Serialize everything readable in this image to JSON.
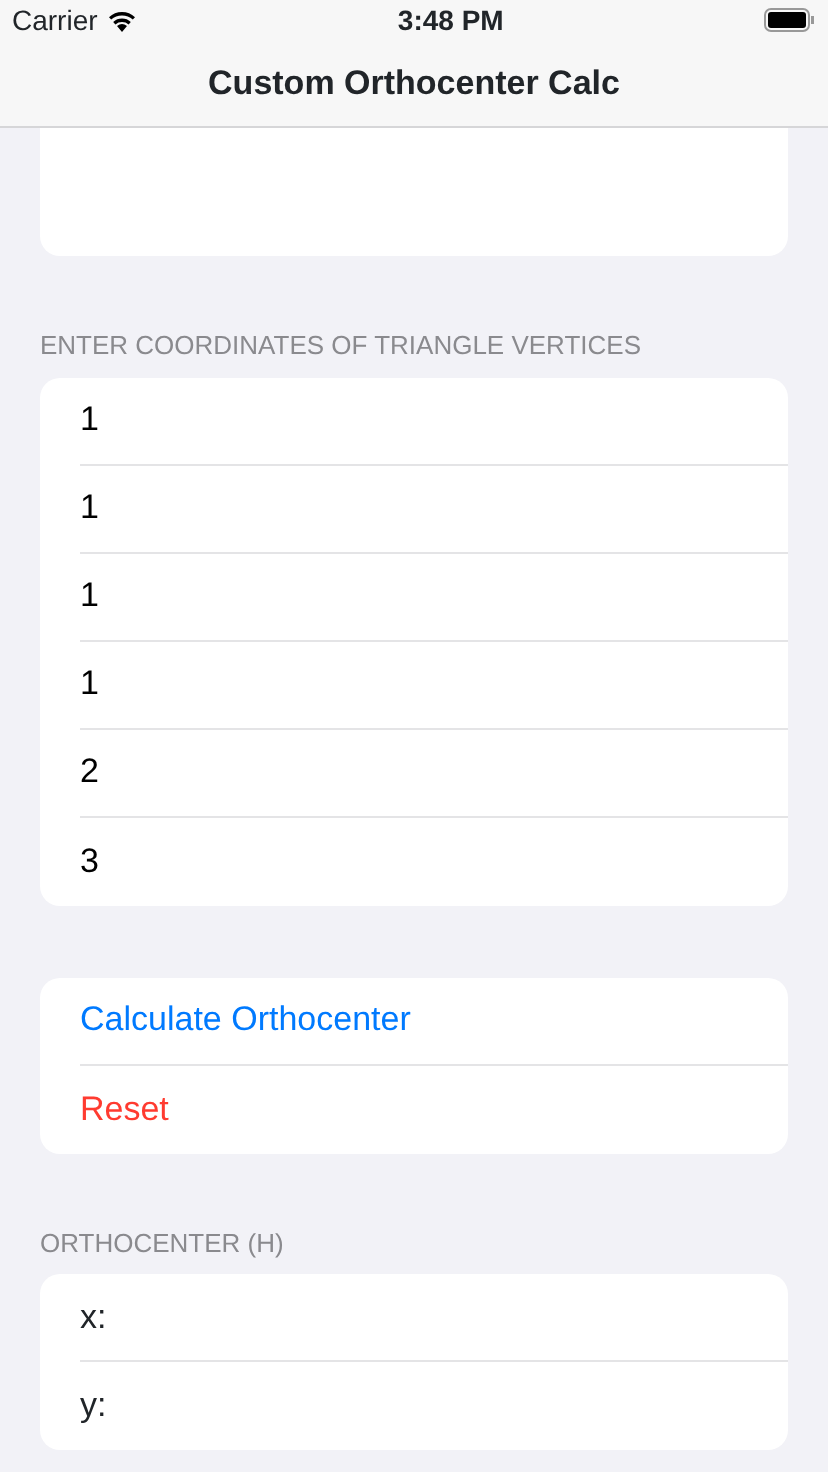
{
  "status_bar": {
    "carrier": "Carrier",
    "time": "3:48 PM"
  },
  "nav_bar": {
    "title": "Custom Orthocenter Calc"
  },
  "vertices_section": {
    "header": "ENTER COORDINATES OF TRIANGLE VERTICES",
    "fields": [
      {
        "value": "1"
      },
      {
        "value": "1"
      },
      {
        "value": "1"
      },
      {
        "value": "1"
      },
      {
        "value": "2"
      },
      {
        "value": "3"
      }
    ]
  },
  "actions": [
    {
      "label": "Calculate Orthocenter",
      "kind": "primary"
    },
    {
      "label": "Reset",
      "kind": "destructive"
    }
  ],
  "result_section": {
    "header": "ORTHOCENTER (H)",
    "rows": [
      {
        "label": "x:"
      },
      {
        "label": "y:"
      }
    ]
  }
}
